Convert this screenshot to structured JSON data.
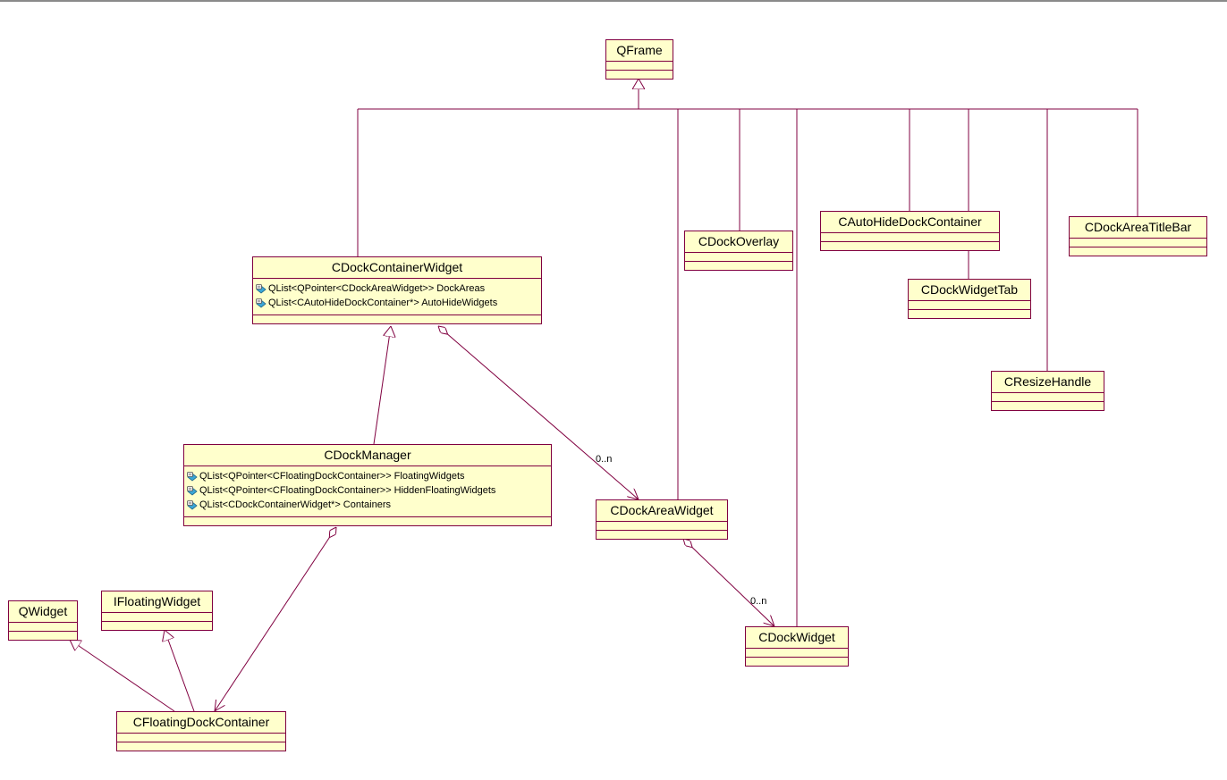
{
  "colors": {
    "box_fill": "#ffffcc",
    "box_border": "#800040",
    "line": "#800040"
  },
  "classes": {
    "qframe": {
      "name": "QFrame"
    },
    "dock_container_widget": {
      "name": "CDockContainerWidget",
      "attributes": [
        "QList<QPointer<CDockAreaWidget>> DockAreas",
        "QList<CAutoHideDockContainer*> AutoHideWidgets"
      ]
    },
    "dock_overlay": {
      "name": "CDockOverlay"
    },
    "auto_hide_dock_container": {
      "name": "CAutoHideDockContainer"
    },
    "dock_area_title_bar": {
      "name": "CDockAreaTitleBar"
    },
    "dock_widget_tab": {
      "name": "CDockWidgetTab"
    },
    "resize_handle": {
      "name": "CResizeHandle"
    },
    "dock_manager": {
      "name": "CDockManager",
      "attributes": [
        "QList<QPointer<CFloatingDockContainer>> FloatingWidgets",
        "QList<QPointer<CFloatingDockContainer>> HiddenFloatingWidgets",
        "QList<CDockContainerWidget*> Containers"
      ]
    },
    "dock_area_widget": {
      "name": "CDockAreaWidget"
    },
    "qwidget": {
      "name": "QWidget"
    },
    "ifloating_widget": {
      "name": "IFloatingWidget"
    },
    "dock_widget": {
      "name": "CDockWidget"
    },
    "floating_dock_container": {
      "name": "CFloatingDockContainer"
    }
  },
  "multiplicities": {
    "container_to_area": "0..n",
    "area_to_widget": "0..n"
  }
}
